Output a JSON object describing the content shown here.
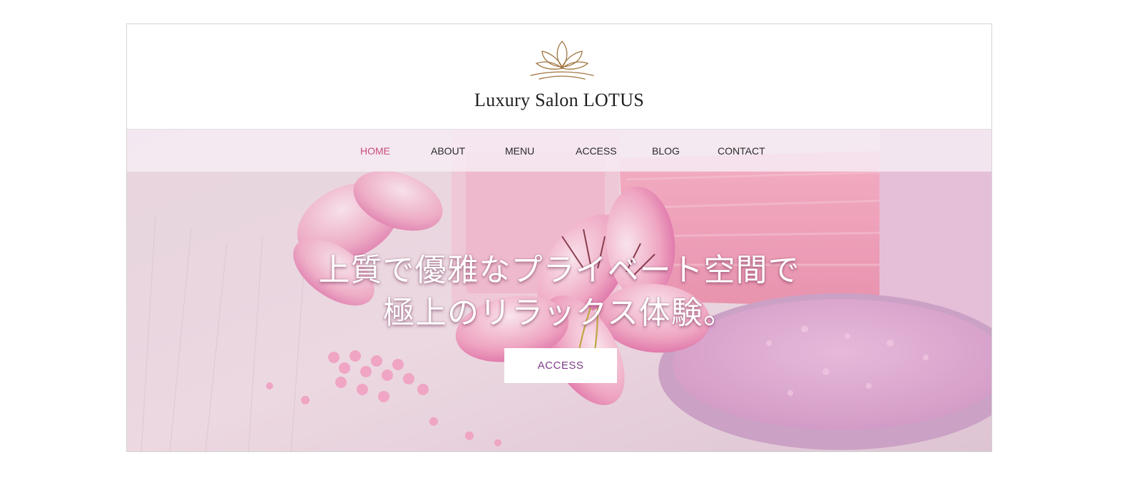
{
  "header": {
    "brand_name": "Luxury Salon LOTUS",
    "logo_icon": "lotus-icon",
    "logo_color": "#a0743f"
  },
  "nav": {
    "items": [
      {
        "label": "HOME",
        "active": true
      },
      {
        "label": "ABOUT",
        "active": false
      },
      {
        "label": "MENU",
        "active": false
      },
      {
        "label": "ACCESS",
        "active": false
      },
      {
        "label": "BLOG",
        "active": false
      },
      {
        "label": "CONTACT",
        "active": false
      }
    ],
    "active_color": "#c84e7a"
  },
  "hero": {
    "headline_line1": "上質で優雅なプライベート空間で",
    "headline_line2": "極上のリラックス体験。",
    "cta_label": "ACCESS",
    "accent_color": "#7e3d8a"
  }
}
